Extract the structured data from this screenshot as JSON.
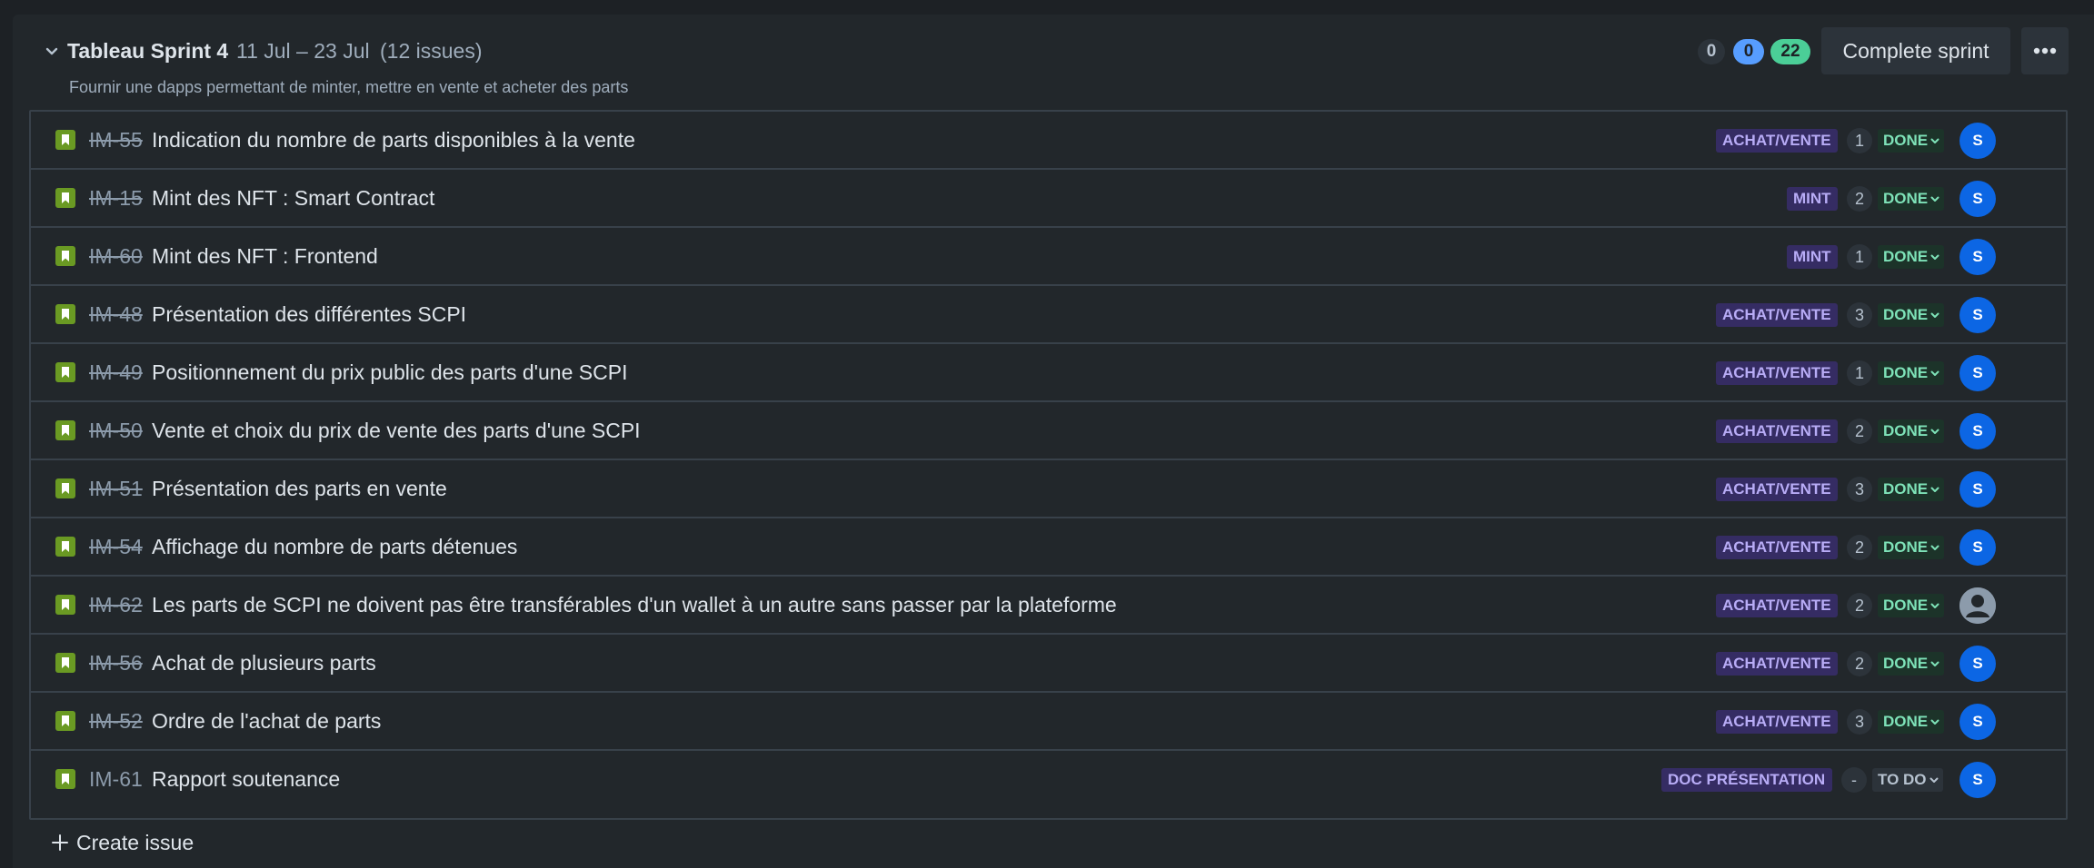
{
  "sprint": {
    "title": "Tableau Sprint 4",
    "dates": "11 Jul – 23 Jul",
    "issue_count": "(12 issues)",
    "goal": "Fournir une dapps permettant de minter, mettre en vente et acheter des parts",
    "counts": {
      "todo": "0",
      "in_progress": "0",
      "done": "22"
    },
    "complete_label": "Complete sprint"
  },
  "colors": {
    "background": "#1d2125",
    "panel": "#22272b",
    "story_green": "#6a9a23",
    "epic_bg": "#352c63",
    "epic_text": "#b8acf6",
    "done_bg": "#1c3329",
    "done_text": "#7ee2b8",
    "avatar_blue": "#0c66e4"
  },
  "issues": [
    {
      "key": "IM-55",
      "summary": "Indication du nombre de parts disponibles à la vente",
      "epic": "ACHAT/VENTE",
      "estimate": "1",
      "status": "DONE",
      "assignee": "S",
      "icon": "story-icon"
    },
    {
      "key": "IM-15",
      "summary": "Mint des NFT : Smart Contract",
      "epic": "MINT",
      "estimate": "2",
      "status": "DONE",
      "assignee": "S",
      "icon": "story-icon"
    },
    {
      "key": "IM-60",
      "summary": "Mint des NFT : Frontend",
      "epic": "MINT",
      "estimate": "1",
      "status": "DONE",
      "assignee": "S",
      "icon": "story-icon"
    },
    {
      "key": "IM-48",
      "summary": "Présentation des différentes SCPI",
      "epic": "ACHAT/VENTE",
      "estimate": "3",
      "status": "DONE",
      "assignee": "S",
      "icon": "story-icon"
    },
    {
      "key": "IM-49",
      "summary": "Positionnement du prix public des parts d'une SCPI",
      "epic": "ACHAT/VENTE",
      "estimate": "1",
      "status": "DONE",
      "assignee": "S",
      "icon": "story-icon"
    },
    {
      "key": "IM-50",
      "summary": "Vente et choix du prix de vente des parts d'une SCPI",
      "epic": "ACHAT/VENTE",
      "estimate": "2",
      "status": "DONE",
      "assignee": "S",
      "icon": "story-icon"
    },
    {
      "key": "IM-51",
      "summary": "Présentation des parts en vente",
      "epic": "ACHAT/VENTE",
      "estimate": "3",
      "status": "DONE",
      "assignee": "S",
      "icon": "story-icon"
    },
    {
      "key": "IM-54",
      "summary": "Affichage du nombre de parts détenues",
      "epic": "ACHAT/VENTE",
      "estimate": "2",
      "status": "DONE",
      "assignee": "S",
      "icon": "story-icon"
    },
    {
      "key": "IM-62",
      "summary": "Les parts de SCPI ne doivent pas être transférables d'un wallet à un autre sans passer par la plateforme",
      "epic": "ACHAT/VENTE",
      "estimate": "2",
      "status": "DONE",
      "assignee": "",
      "icon": "story-icon"
    },
    {
      "key": "IM-56",
      "summary": "Achat de plusieurs parts",
      "epic": "ACHAT/VENTE",
      "estimate": "2",
      "status": "DONE",
      "assignee": "S",
      "icon": "story-icon"
    },
    {
      "key": "IM-52",
      "summary": "Ordre de l'achat de parts",
      "epic": "ACHAT/VENTE",
      "estimate": "3",
      "status": "DONE",
      "assignee": "S",
      "icon": "story-icon"
    },
    {
      "key": "IM-61",
      "summary": "Rapport soutenance",
      "epic": "DOC PRÉSENTATION",
      "estimate": "-",
      "status": "TO DO",
      "assignee": "S",
      "icon": "story-icon"
    }
  ],
  "create_issue_label": "Create issue"
}
